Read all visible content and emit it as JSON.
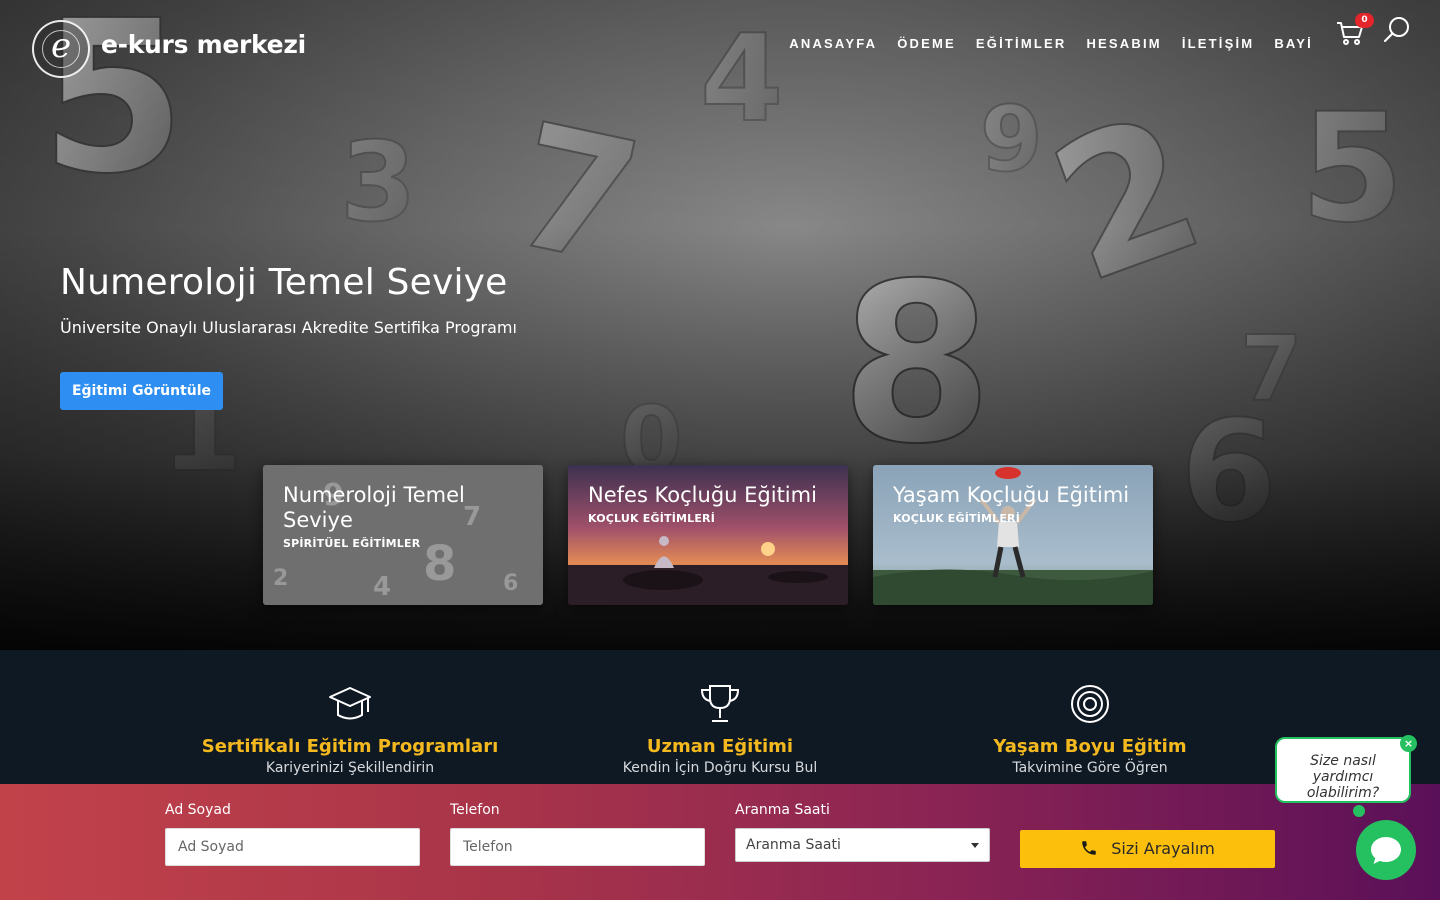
{
  "brand": {
    "logo_text": "e-kurs merkezi",
    "logo_letter": "e"
  },
  "nav": {
    "items": [
      "ANASAYFA",
      "ÖDEME",
      "EĞİTİMLER",
      "HESABIM",
      "İLETİŞİM",
      "BAYİ"
    ]
  },
  "header_icons": {
    "cart_icon": "cart-icon",
    "cart_count": "0",
    "search_icon": "search-icon"
  },
  "hero": {
    "title": "Numeroloji Temel Seviye",
    "subtitle": "Üniversite  Onaylı  Uluslararası Akredite Sertifika Programı",
    "button": "Eğitimi Görüntüle"
  },
  "cards": [
    {
      "title": "Numeroloji Temel Seviye",
      "category": "SPİRİTÜEL EĞİTİMLER"
    },
    {
      "title": "Nefes Koçluğu Eğitimi",
      "category": "KOÇLUK EĞİTİMLERİ"
    },
    {
      "title": "Yaşam Koçluğu Eğitimi",
      "category": "KOÇLUK EĞİTİMLERİ"
    }
  ],
  "features": [
    {
      "icon": "graduation-cap-icon",
      "title": "Sertifikalı Eğitim Programları",
      "subtitle": "Kariyerinizi Şekillendirin"
    },
    {
      "icon": "trophy-icon",
      "title": "Uzman Eğitimi",
      "subtitle": "Kendin İçin Doğru Kursu Bul"
    },
    {
      "icon": "target-icon",
      "title": "Yaşam Boyu Eğitim",
      "subtitle": "Takvimine Göre Öğren"
    }
  ],
  "callback_form": {
    "name_label": "Ad Soyad",
    "name_placeholder": "Ad Soyad",
    "phone_label": "Telefon",
    "phone_placeholder": "Telefon",
    "time_label": "Aranma Saati",
    "time_selected": "Aranma Saati",
    "submit": "Sizi Arayalım"
  },
  "chat": {
    "bubble_text": "Size nasıl yardımcı olabilirim?",
    "close": "×"
  },
  "colors": {
    "accent_blue": "#2f8ef1",
    "feature_gold": "#f4b91e",
    "call_button": "#fbbf0c",
    "chat_green": "#25c05f",
    "badge_red": "#e3262b",
    "features_bg": "#0f1923"
  }
}
